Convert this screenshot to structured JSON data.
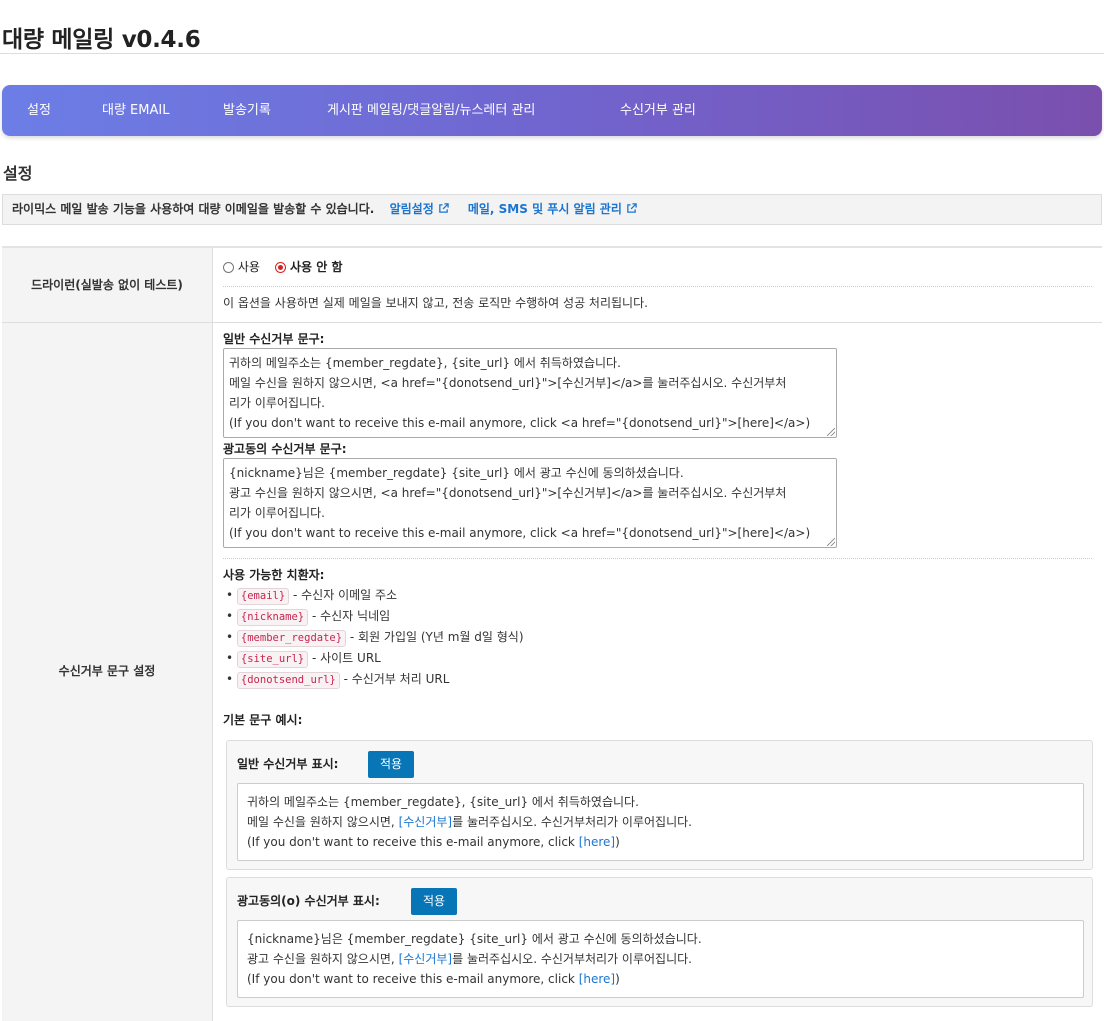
{
  "page": {
    "title": "대량 메일링 v0.4.6"
  },
  "nav": {
    "items": [
      "설정",
      "대량 EMAIL",
      "발송기록",
      "게시판 메일링/댓글알림/뉴스레터 관리",
      "수신거부 관리"
    ]
  },
  "section": {
    "title": "설정"
  },
  "info": {
    "text": "라이믹스 메일 발송 기능을 사용하여 대량 이메일을 발송할 수 있습니다.",
    "link1": "알림설정",
    "link2": "메일, SMS 및 푸시 알림 관리"
  },
  "dry_run": {
    "label": "드라이런(실발송 없이 테스트)",
    "option_use": "사용",
    "option_not_use": "사용 안 함",
    "selected": "사용 안 함",
    "help": "이 옵션을 사용하면 실제 메일을 보내지 않고, 전송 로직만 수행하여 성공 처리됩니다."
  },
  "unsubscribe": {
    "label": "수신거부 문구 설정",
    "general_label": "일반 수신거부 문구:",
    "general_text": {
      "line1": "귀하의 메일주소는 {member_regdate}, {site_url} 에서 취득하였습니다.",
      "line2": "메일 수신을 원하지 않으시면, <a href=\"{donotsend_url}\">[수신거부]</a>를 눌러주십시오. 수신거부처",
      "line3": "리가 이루어집니다.",
      "line4": "(If you don't want to receive this e-mail anymore, click <a href=\"{donotsend_url}\">[here]</a>)"
    },
    "ad_label": "광고동의 수신거부 문구:",
    "ad_text": {
      "line1": "{nickname}님은 {member_regdate} {site_url} 에서 광고 수신에 동의하셨습니다.",
      "line2": "광고 수신을 원하지 않으시면, <a href=\"{donotsend_url}\">[수신거부]</a>를 눌러주십시오. 수신거부처",
      "line3": "리가 이루어집니다.",
      "line4": "(If you don't want to receive this e-mail anymore, click <a href=\"{donotsend_url}\">[here]</a>)"
    },
    "tokens_title": "사용 가능한 치환자:",
    "tokens": [
      {
        "code": "{email}",
        "desc": "- 수신자 이메일 주소"
      },
      {
        "code": "{nickname}",
        "desc": "- 수신자 닉네임"
      },
      {
        "code": "{member_regdate}",
        "desc": "- 회원 가입일 (Y년 m월 d일 형식)"
      },
      {
        "code": "{site_url}",
        "desc": "- 사이트 URL"
      },
      {
        "code": "{donotsend_url}",
        "desc": "- 수신거부 처리 URL"
      }
    ],
    "examples_title": "기본 문구 예시:",
    "apply_label": "적용",
    "example_general": {
      "title": "일반 수신거부 표시:",
      "line1": "귀하의 메일주소는 {member_regdate}, {site_url} 에서 취득하였습니다.",
      "line2_pre": "메일 수신을 원하지 않으시면, ",
      "line2_link": "[수신거부]",
      "line2_post": "를 눌러주십시오. 수신거부처리가 이루어집니다.",
      "line3_pre": "(If you don't want to receive this e-mail anymore, click ",
      "line3_link": "[here]",
      "line3_post": ")"
    },
    "example_ad": {
      "title": "광고동의(o) 수신거부 표시:",
      "line1": "{nickname}님은 {member_regdate} {site_url} 에서 광고 수신에 동의하셨습니다.",
      "line2_pre": "광고 수신을 원하지 않으시면, ",
      "line2_link": "[수신거부]",
      "line2_post": "를 눌러주십시오. 수신거부처리가 이루어집니다.",
      "line3_pre": "(If you don't want to receive this e-mail anymore, click ",
      "line3_link": "[here]",
      "line3_post": ")"
    }
  },
  "colors": {
    "nav_start": "#6c7ee6",
    "nav_end": "#7a4fae",
    "link": "#1b75d0",
    "button": "#0876b6",
    "radio_selected": "#d62020"
  }
}
